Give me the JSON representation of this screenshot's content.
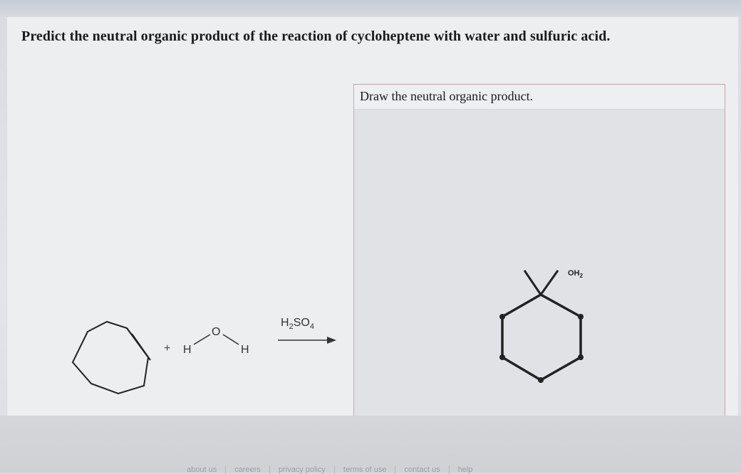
{
  "question": {
    "text": "Predict the neutral organic product of the reaction of cycloheptene with water and sulfuric acid."
  },
  "reaction": {
    "plus": "+",
    "water_h_left": "H",
    "water_o": "O",
    "water_h_right": "H",
    "reagent_main": "H",
    "reagent_sub2": "2",
    "reagent_so": "SO",
    "reagent_sub4": "4"
  },
  "answer": {
    "prompt": "Draw the neutral organic product.",
    "product_label_main": "OH",
    "product_label_sub": "2"
  },
  "footer": {
    "links": [
      "about us",
      "careers",
      "privacy policy",
      "terms of use",
      "contact us",
      "help"
    ]
  }
}
